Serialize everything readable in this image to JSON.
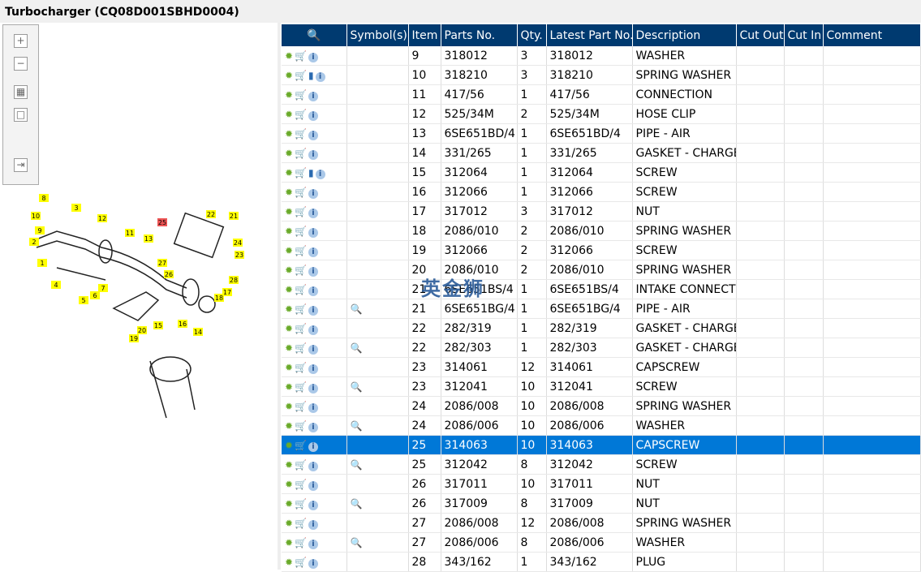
{
  "title": "Turbocharger (CQ08D001SBHD0004)",
  "watermark": "英金狮",
  "columns": [
    "Symbol(s)",
    "Item",
    "Parts No.",
    "Qty.",
    "Latest Part No.",
    "Description",
    "Cut Out",
    "Cut In",
    "Comment"
  ],
  "rows": [
    {
      "item": "9",
      "part": "318012",
      "qty": "3",
      "latest": "318012",
      "desc": "WASHER",
      "book": false,
      "sym": false
    },
    {
      "item": "10",
      "part": "318210",
      "qty": "3",
      "latest": "318210",
      "desc": "SPRING WASHER",
      "book": true,
      "sym": false
    },
    {
      "item": "11",
      "part": "417/56",
      "qty": "1",
      "latest": "417/56",
      "desc": "CONNECTION",
      "book": false,
      "sym": false
    },
    {
      "item": "12",
      "part": "525/34M",
      "qty": "2",
      "latest": "525/34M",
      "desc": "HOSE CLIP",
      "book": false,
      "sym": false
    },
    {
      "item": "13",
      "part": "6SE651BD/4",
      "qty": "1",
      "latest": "6SE651BD/4",
      "desc": "PIPE - AIR",
      "book": false,
      "sym": false
    },
    {
      "item": "14",
      "part": "331/265",
      "qty": "1",
      "latest": "331/265",
      "desc": "GASKET - CHARGE",
      "book": false,
      "sym": false
    },
    {
      "item": "15",
      "part": "312064",
      "qty": "1",
      "latest": "312064",
      "desc": "SCREW",
      "book": true,
      "sym": false
    },
    {
      "item": "16",
      "part": "312066",
      "qty": "1",
      "latest": "312066",
      "desc": "SCREW",
      "book": false,
      "sym": false
    },
    {
      "item": "17",
      "part": "317012",
      "qty": "3",
      "latest": "317012",
      "desc": "NUT",
      "book": false,
      "sym": false
    },
    {
      "item": "18",
      "part": "2086/010",
      "qty": "2",
      "latest": "2086/010",
      "desc": "SPRING WASHER",
      "book": false,
      "sym": false
    },
    {
      "item": "19",
      "part": "312066",
      "qty": "2",
      "latest": "312066",
      "desc": "SCREW",
      "book": false,
      "sym": false
    },
    {
      "item": "20",
      "part": "2086/010",
      "qty": "2",
      "latest": "2086/010",
      "desc": "SPRING WASHER",
      "book": false,
      "sym": false
    },
    {
      "item": "21",
      "part": "6SE651BS/4",
      "qty": "1",
      "latest": "6SE651BS/4",
      "desc": "INTAKE CONNECT",
      "book": false,
      "sym": false
    },
    {
      "item": "21",
      "part": "6SE651BG/4",
      "qty": "1",
      "latest": "6SE651BG/4",
      "desc": "PIPE - AIR",
      "book": false,
      "sym": true
    },
    {
      "item": "22",
      "part": "282/319",
      "qty": "1",
      "latest": "282/319",
      "desc": "GASKET - CHARGE",
      "book": false,
      "sym": false
    },
    {
      "item": "22",
      "part": "282/303",
      "qty": "1",
      "latest": "282/303",
      "desc": "GASKET - CHARGE",
      "book": false,
      "sym": true
    },
    {
      "item": "23",
      "part": "314061",
      "qty": "12",
      "latest": "314061",
      "desc": "CAPSCREW",
      "book": false,
      "sym": false
    },
    {
      "item": "23",
      "part": "312041",
      "qty": "10",
      "latest": "312041",
      "desc": "SCREW",
      "book": false,
      "sym": true
    },
    {
      "item": "24",
      "part": "2086/008",
      "qty": "10",
      "latest": "2086/008",
      "desc": "SPRING WASHER",
      "book": false,
      "sym": false
    },
    {
      "item": "24",
      "part": "2086/006",
      "qty": "10",
      "latest": "2086/006",
      "desc": "WASHER",
      "book": false,
      "sym": true
    },
    {
      "item": "25",
      "part": "314063",
      "qty": "10",
      "latest": "314063",
      "desc": "CAPSCREW",
      "book": false,
      "sym": false,
      "selected": true
    },
    {
      "item": "25",
      "part": "312042",
      "qty": "8",
      "latest": "312042",
      "desc": "SCREW",
      "book": false,
      "sym": true
    },
    {
      "item": "26",
      "part": "317011",
      "qty": "10",
      "latest": "317011",
      "desc": "NUT",
      "book": false,
      "sym": false
    },
    {
      "item": "26",
      "part": "317009",
      "qty": "8",
      "latest": "317009",
      "desc": "NUT",
      "book": false,
      "sym": true
    },
    {
      "item": "27",
      "part": "2086/008",
      "qty": "12",
      "latest": "2086/008",
      "desc": "SPRING WASHER",
      "book": false,
      "sym": false
    },
    {
      "item": "27",
      "part": "2086/006",
      "qty": "8",
      "latest": "2086/006",
      "desc": "WASHER",
      "book": false,
      "sym": true
    },
    {
      "item": "28",
      "part": "343/162",
      "qty": "1",
      "latest": "343/162",
      "desc": "PLUG",
      "book": false,
      "sym": false
    }
  ],
  "callouts": [
    "8",
    "3",
    "10",
    "9",
    "2",
    "1",
    "12",
    "11",
    "13",
    "4",
    "5",
    "6",
    "7",
    "25",
    "22",
    "21",
    "24",
    "23",
    "27",
    "26",
    "28",
    "17",
    "18",
    "14",
    "16",
    "15",
    "19",
    "20"
  ]
}
